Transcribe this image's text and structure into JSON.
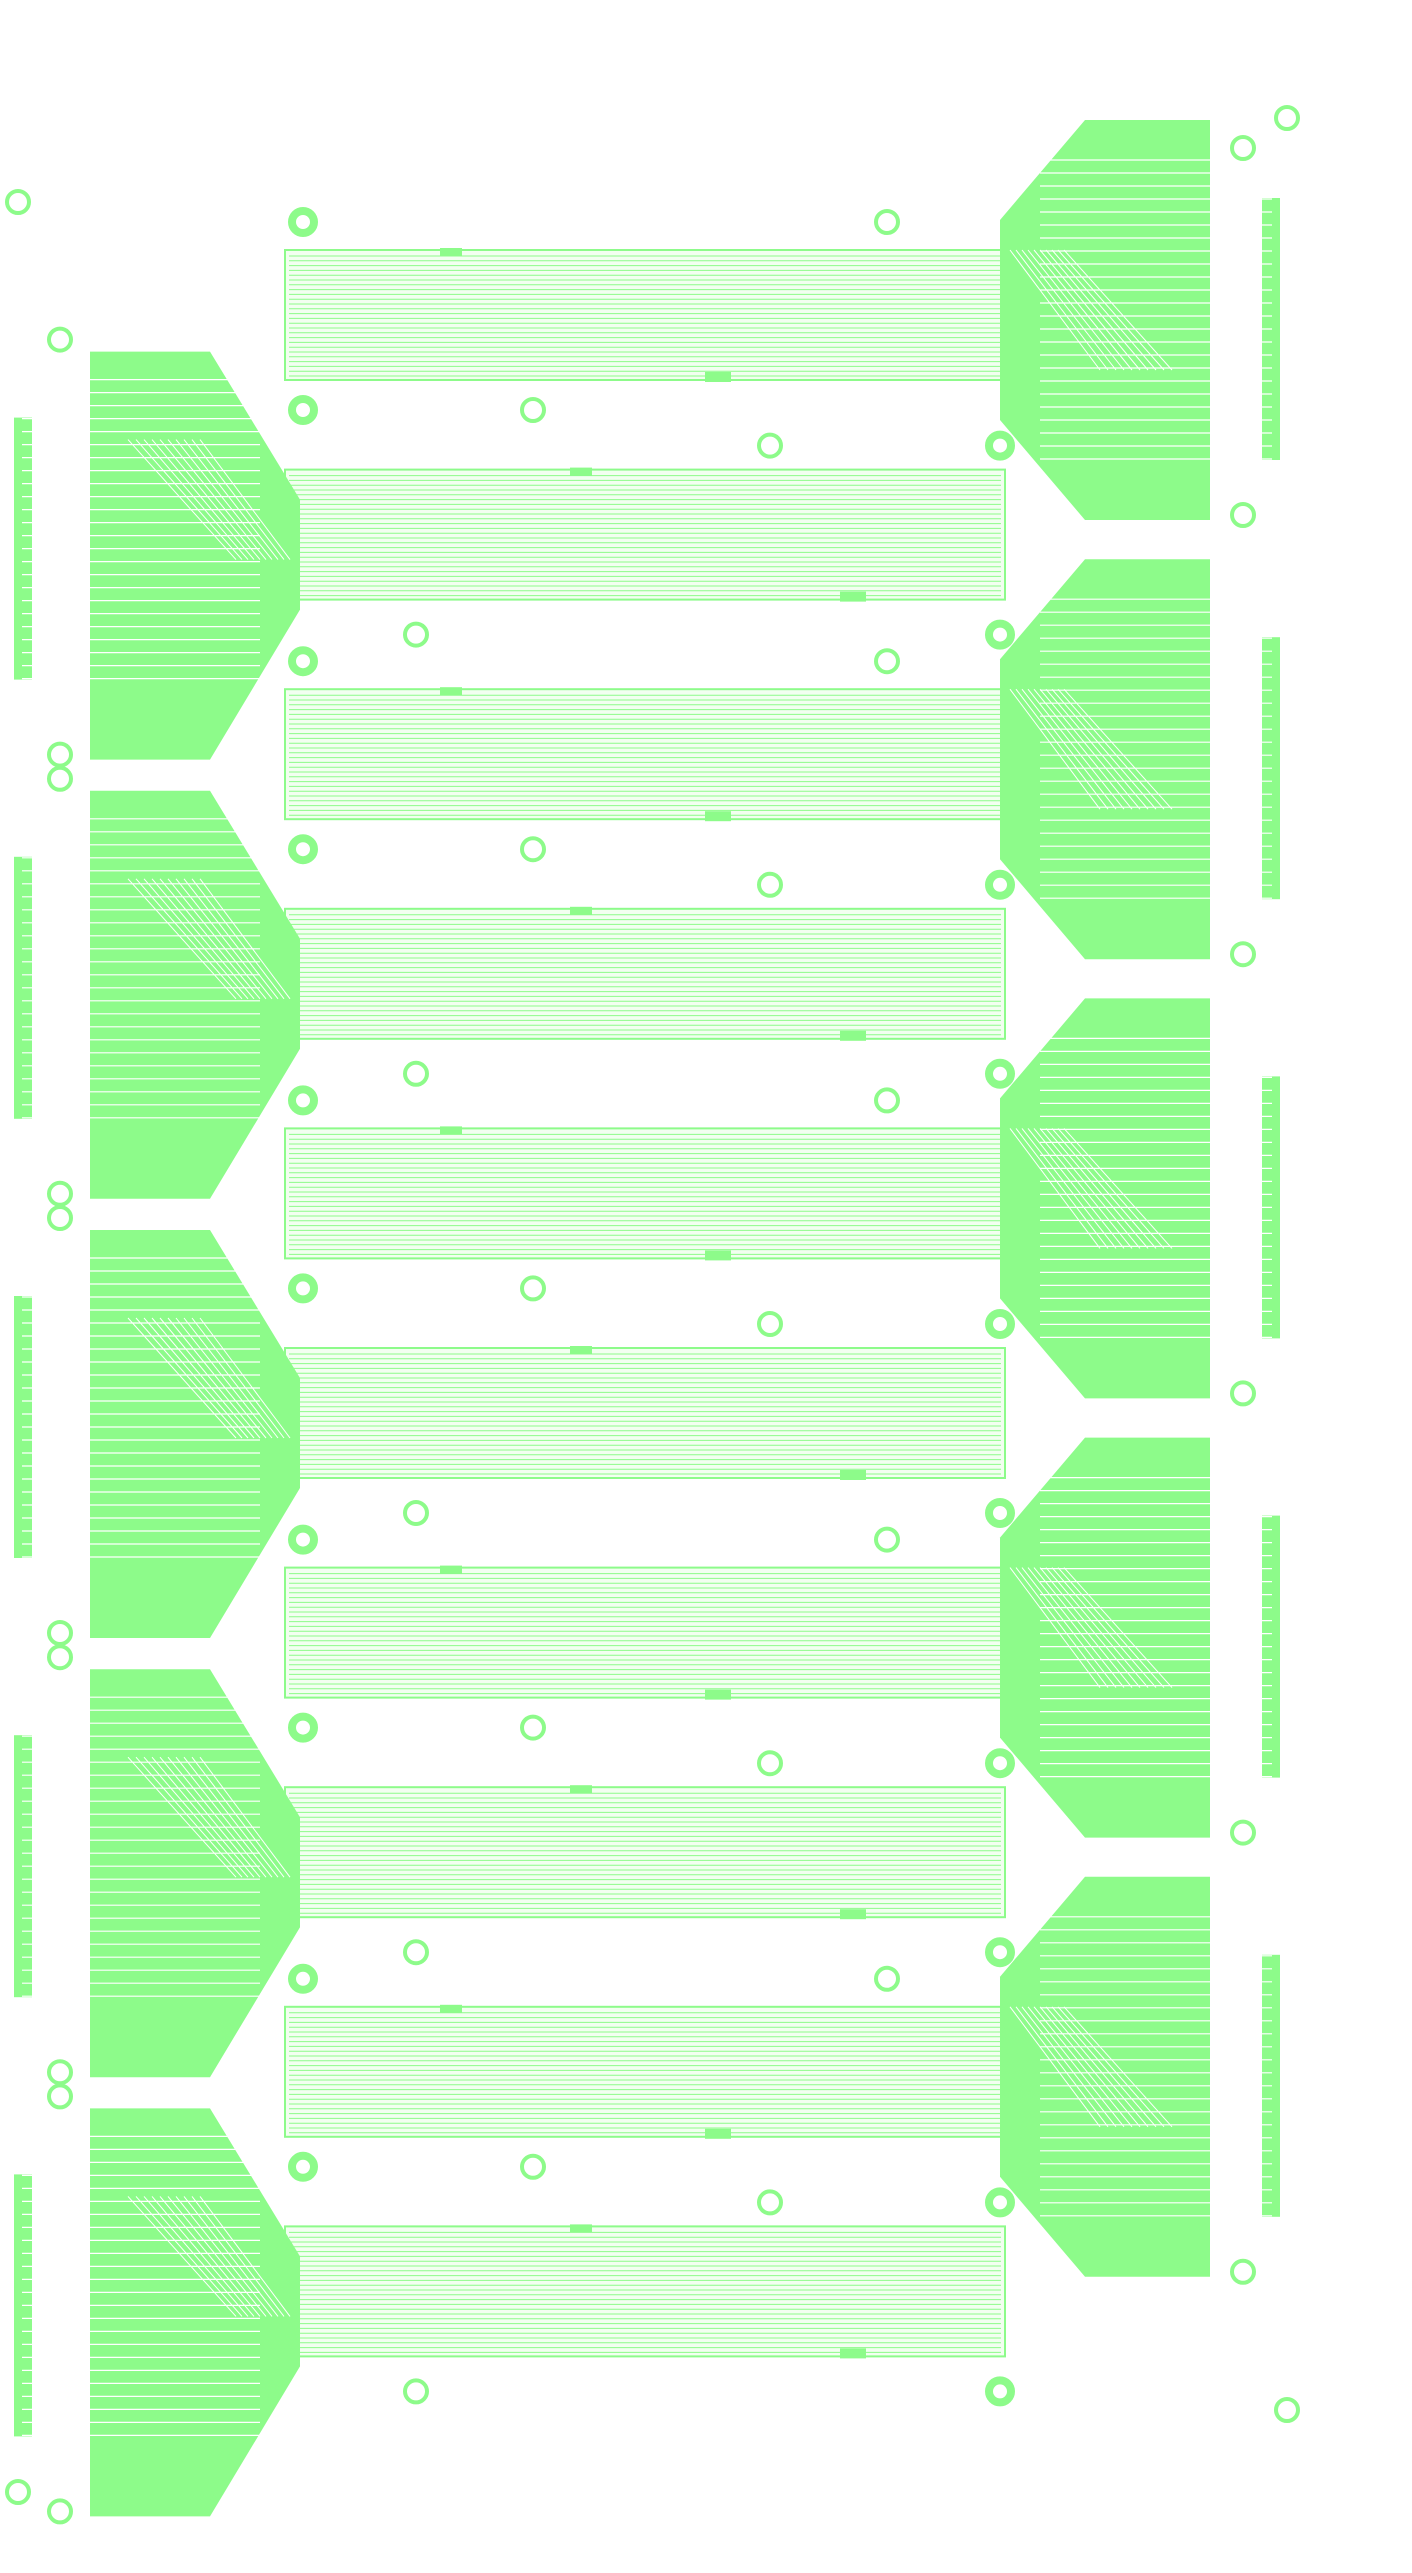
{
  "colors": {
    "copper": "#8dfb8a",
    "background": "#ffffff",
    "cable_fill": "#f2fff0"
  },
  "flex_circuits": [
    {
      "side": "right"
    },
    {
      "side": "left"
    },
    {
      "side": "right"
    },
    {
      "side": "left"
    },
    {
      "side": "right"
    },
    {
      "side": "left"
    },
    {
      "side": "right"
    },
    {
      "side": "left"
    },
    {
      "side": "right"
    },
    {
      "side": "left"
    }
  ]
}
